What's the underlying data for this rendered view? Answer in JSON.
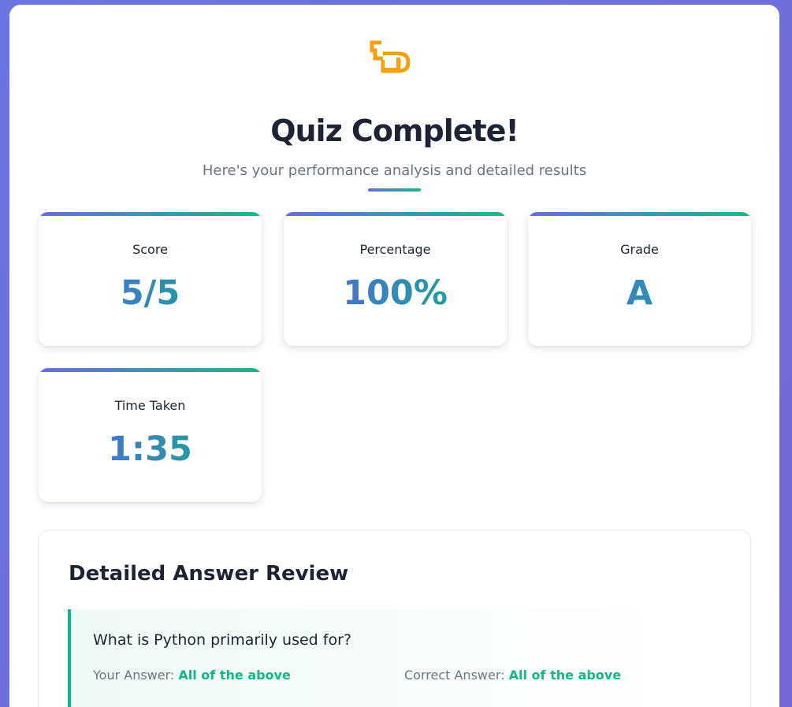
{
  "trophy_icon": "trophy-icon",
  "accent_colors": {
    "gradient_start": "#6a6ce0",
    "gradient_end": "#12bb87",
    "correct": "#14b886",
    "trophy": "#f5a00c"
  },
  "header": {
    "title": "Quiz Complete!",
    "subtitle": "Here's your performance analysis and detailed results"
  },
  "stats": [
    {
      "label": "Score",
      "value": "5/5"
    },
    {
      "label": "Percentage",
      "value": "100%"
    },
    {
      "label": "Grade",
      "value": "A"
    },
    {
      "label": "Time Taken",
      "value": "1:35"
    }
  ],
  "review": {
    "title": "Detailed Answer Review",
    "items": [
      {
        "question": "What is Python primarily used for?",
        "your_answer_label": "Your Answer:",
        "your_answer": "All of the above",
        "correct_answer_label": "Correct Answer:",
        "correct_answer": "All of the above"
      }
    ]
  }
}
